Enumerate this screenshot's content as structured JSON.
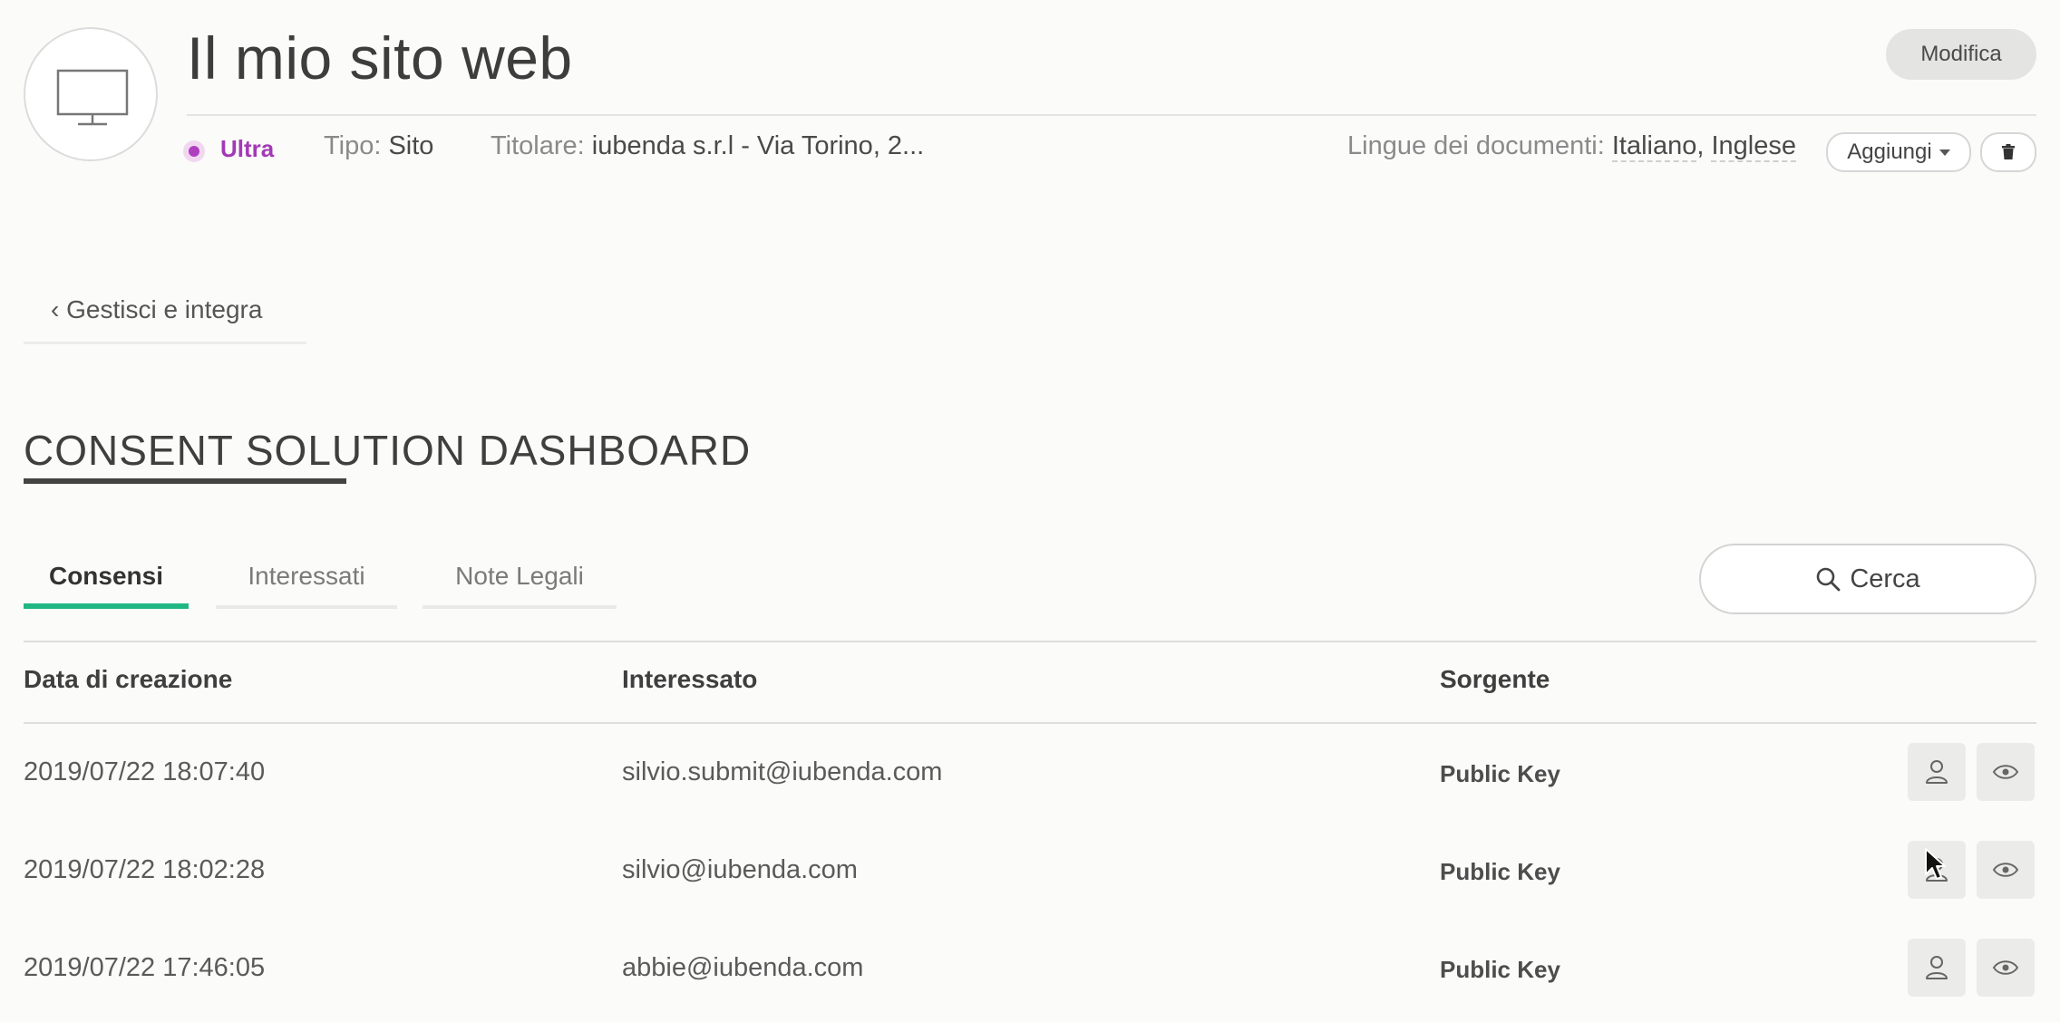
{
  "header": {
    "site_title": "Il mio sito web",
    "edit_label": "Modifica",
    "plan": "Ultra",
    "type_key": "Tipo:",
    "type_value": "Sito",
    "owner_key": "Titolare:",
    "owner_value": "iubenda s.r.l - Via Torino, 2...",
    "languages_key": "Lingue dei documenti:",
    "languages": [
      "Italiano",
      "Inglese"
    ],
    "add_label": "Aggiungi",
    "site_icon": "monitor-icon",
    "delete_icon": "trash-icon"
  },
  "nav": {
    "back_label": "‹ Gestisci e integra"
  },
  "section": {
    "title": "CONSENT SOLUTION DASHBOARD"
  },
  "tabs": [
    {
      "label": "Consensi",
      "active": true
    },
    {
      "label": "Interessati",
      "active": false
    },
    {
      "label": "Note Legali",
      "active": false
    }
  ],
  "search": {
    "label": "Cerca",
    "icon": "search-icon"
  },
  "table": {
    "columns": [
      "Data di creazione",
      "Interessato",
      "Sorgente"
    ],
    "rows": [
      {
        "date": "2019/07/22 18:07:40",
        "subject": "silvio.submit@iubenda.com",
        "source": "Public Key"
      },
      {
        "date": "2019/07/22 18:02:28",
        "subject": "silvio@iubenda.com",
        "source": "Public Key"
      },
      {
        "date": "2019/07/22 17:46:05",
        "subject": "abbie@iubenda.com",
        "source": "Public Key"
      }
    ],
    "row_actions": [
      "user-icon",
      "eye-icon"
    ]
  },
  "colors": {
    "accent_green": "#21b784",
    "plan_purple": "#a23ab5"
  }
}
